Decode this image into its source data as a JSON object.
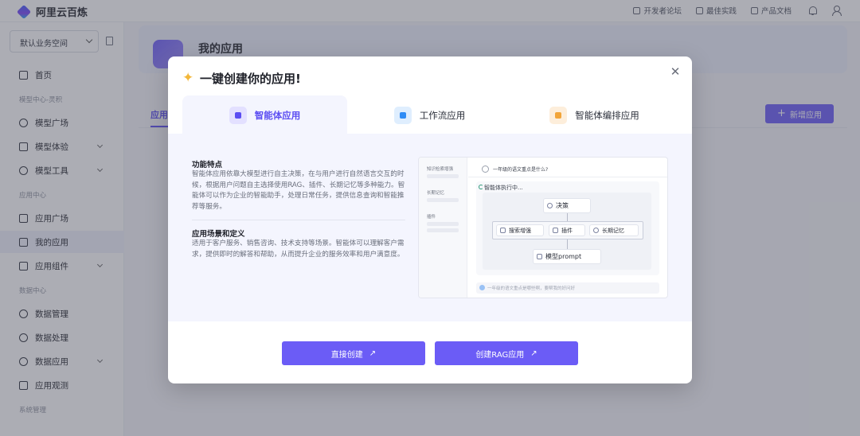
{
  "topbar": {
    "brand": "阿里云百炼",
    "links": [
      "开发者论坛",
      "最佳实践",
      "产品文档"
    ]
  },
  "sidebar": {
    "workspace": "默认业务空间",
    "items": [
      {
        "label": "首页"
      },
      {
        "section": "模型中心-灵积"
      },
      {
        "label": "模型广场"
      },
      {
        "label": "模型体验"
      },
      {
        "label": "模型工具"
      },
      {
        "section": "应用中心"
      },
      {
        "label": "应用广场"
      },
      {
        "label": "我的应用"
      },
      {
        "label": "应用组件"
      },
      {
        "section": "数据中心"
      },
      {
        "label": "数据管理"
      },
      {
        "label": "数据处理"
      },
      {
        "label": "数据应用"
      },
      {
        "label": "应用观测"
      },
      {
        "section": "系统管理"
      }
    ]
  },
  "main": {
    "title": "我的应用",
    "tab": "应用",
    "add_button": "新增应用"
  },
  "modal": {
    "title": "一键创建你的应用!",
    "tabs": [
      "智能体应用",
      "工作流应用",
      "智能体编排应用"
    ],
    "active_tab": 0,
    "feature_title": "功能特点",
    "feature_text": "智能体应用依靠大模型进行自主决策，在与用户进行自然语言交互的时候，根据用户问题自主选择使用RAG、插件、长期记忆等多种能力。智能体可以作为企业的智能助手，处理日常任务，提供信息查询和智能推荐等服务。",
    "scene_title": "应用场景和定义",
    "scene_text": "适用于客户服务、销售咨询、技术支持等场景。智能体可以理解客户需求，提供即时的解答和帮助，从而提升企业的服务效率和用户满意度。",
    "preview": {
      "side_labels": [
        "知识检索增强",
        "长期记忆",
        "插件"
      ],
      "question": "一年级的语文重点是什么?",
      "running": "智能体执行中...",
      "nodes": {
        "decision": "决策",
        "search": "搜索增强",
        "plugin": "插件",
        "memory": "长期记忆",
        "model": "模型prompt"
      },
      "input_placeholder": "一年级的语文重点是哪些啊，要帮我的好问好"
    },
    "buttons": [
      "直接创建",
      "创建RAG应用"
    ]
  }
}
